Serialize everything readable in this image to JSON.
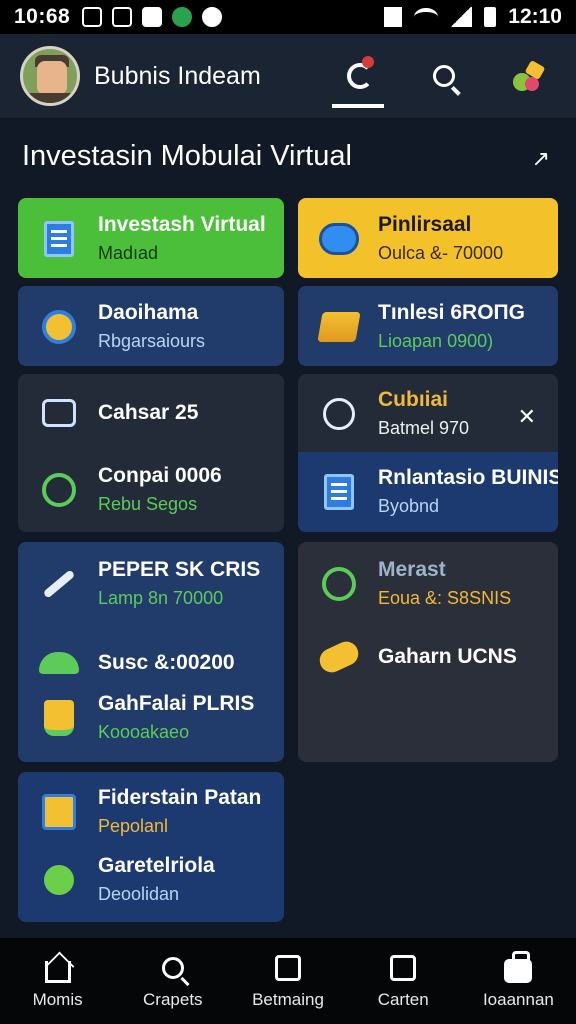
{
  "status_bar": {
    "time_left": "10:68",
    "time_right": "12:10"
  },
  "header": {
    "app_title": "Bubnis Indeam"
  },
  "section": {
    "title": "Investasin Mobulai Virtual"
  },
  "cards": {
    "card1": {
      "title": "Investash Virtual",
      "subtitle": "Madıad"
    },
    "card2": {
      "title": "Pinlirsaal",
      "subtitle": "Oulca &- 70000"
    },
    "card3": {
      "title": "Daoihama",
      "subtitle": "Rbgarsaiours"
    },
    "card4": {
      "title": "Tınlesi 6ROПG",
      "subtitle": "Lioapan 0900)"
    },
    "card5": {
      "item1": {
        "title": "Cahsar 25"
      },
      "item2": {
        "title": "Conpai 0006",
        "subtitle": "Rebu Segos"
      }
    },
    "card6": {
      "item1": {
        "title": "Cubıiai",
        "subtitle": "Batmel 970"
      },
      "item2": {
        "title": "Rnlantasio BUINIS",
        "subtitle": "Byobnd"
      }
    },
    "card7": {
      "item1": {
        "title": "PEPER SK CRIS",
        "subtitle": "Lamp 8n 70000"
      },
      "item2": {
        "title": "Susc &:00200"
      },
      "item3": {
        "title": "GahFalai PLRIS",
        "subtitle": "Koooakaeo"
      }
    },
    "card8": {
      "item1": {
        "title": "Merast",
        "subtitle": "Eoua &: S8SNIS"
      },
      "item2": {
        "title": "Gaharn UCNS"
      }
    },
    "card9": {
      "item1": {
        "title": "Fiderstain Patan",
        "subtitle": "Pepolanl"
      },
      "item2": {
        "title": "Garetelriola",
        "subtitle": "Deoolidan"
      }
    }
  },
  "bottom_nav": [
    {
      "label": "Momis",
      "icon": "home-icon"
    },
    {
      "label": "Crapets",
      "icon": "search-icon"
    },
    {
      "label": "Betmaing",
      "icon": "upload-box-icon"
    },
    {
      "label": "Carten",
      "icon": "mail-box-icon"
    },
    {
      "label": "Ioaannan",
      "icon": "bag-icon"
    }
  ],
  "colors": {
    "accent_green": "#4cbf3a",
    "accent_yellow": "#f3c22a",
    "card_blue": "#213b6b",
    "card_dark": "#242b38",
    "background": "#121926"
  }
}
